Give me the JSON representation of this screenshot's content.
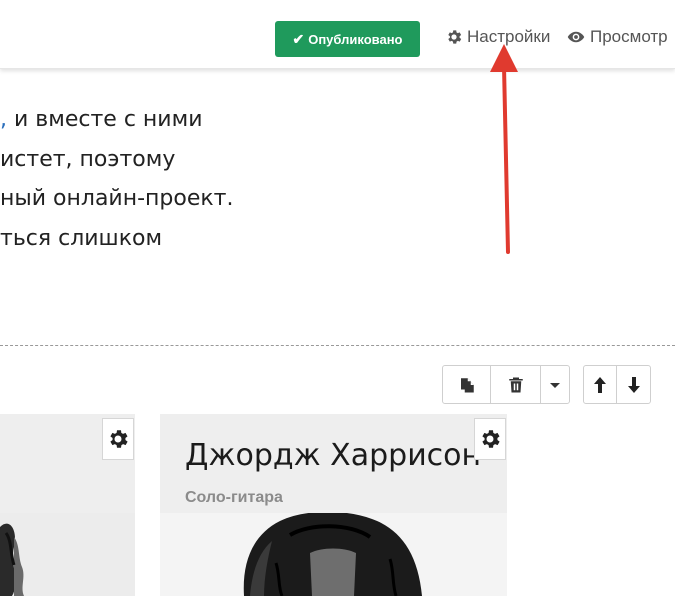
{
  "toolbar": {
    "published_label": "Опубликовано",
    "settings_label": "Настройки",
    "preview_label": "Просмотр"
  },
  "content": {
    "lines": [
      {
        "link_fragment": ",",
        "text": " и вместе с ними"
      },
      {
        "text": "истет, поэтому"
      },
      {
        "text": "ный онлайн-проект."
      },
      {
        "text": "ться слишком"
      }
    ]
  },
  "cards": [
    {
      "name": "",
      "role": ""
    },
    {
      "name": "Джордж Харрисон",
      "role": "Соло-гитара"
    }
  ],
  "icons": {
    "published": "check-icon",
    "settings": "gear-icon",
    "preview": "eye-icon",
    "copy": "copy-icon",
    "delete": "trash-icon",
    "dropdown": "caret-down-icon",
    "move_up": "arrow-up-icon",
    "move_down": "arrow-down-icon",
    "card_settings": "gear-icon"
  },
  "colors": {
    "published_bg": "#1f9a5c",
    "annotation_arrow": "#e03a2f",
    "link": "#2a6ebb"
  }
}
